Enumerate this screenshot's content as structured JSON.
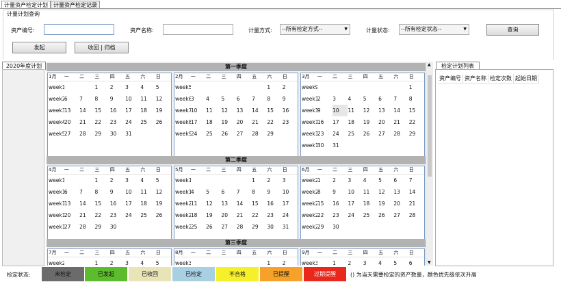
{
  "tabs": [
    {
      "label": "计量资产检定计划",
      "active": true
    },
    {
      "label": "计量资产检定记录",
      "active": false
    }
  ],
  "query": {
    "title": "计量计划查询",
    "asset_no_label": "资产编号:",
    "asset_name_label": "资产名称:",
    "method_label": "计量方式:",
    "method_value": "--所有检定方式--",
    "status_label": "计量状态:",
    "status_value": "--所有检定状态--",
    "search_label": "查询",
    "start_label": "发起",
    "recall_label": "收回 | 归档"
  },
  "year_tab": "2020年度计划",
  "list": {
    "tab": "检定计划列表",
    "columns": [
      "资产编号",
      "资产名称",
      "检定次数",
      "起始日期"
    ]
  },
  "weekday_headers": [
    "一",
    "二",
    "三",
    "四",
    "五",
    "六",
    "日"
  ],
  "quarters": [
    {
      "title": "第一季度",
      "months": [
        {
          "name": "1月",
          "rows": [
            {
              "w": "week1",
              "d": [
                "",
                "",
                "1",
                "2",
                "3",
                "4",
                "5"
              ]
            },
            {
              "w": "week2",
              "d": [
                "6",
                "7",
                "8",
                "9",
                "10",
                "11",
                "12"
              ]
            },
            {
              "w": "week3",
              "d": [
                "13",
                "14",
                "15",
                "16",
                "17",
                "18",
                "19"
              ]
            },
            {
              "w": "week4",
              "d": [
                "20",
                "21",
                "22",
                "23",
                "24",
                "25",
                "26"
              ]
            },
            {
              "w": "week5",
              "d": [
                "27",
                "28",
                "29",
                "30",
                "31",
                "",
                ""
              ]
            },
            {
              "w": "",
              "d": [
                "",
                "",
                "",
                "",
                "",
                "",
                ""
              ]
            }
          ]
        },
        {
          "name": "2月",
          "rows": [
            {
              "w": "week5",
              "d": [
                "",
                "",
                "",
                "",
                "",
                "1",
                "2"
              ]
            },
            {
              "w": "week6",
              "d": [
                "3",
                "4",
                "5",
                "6",
                "7",
                "8",
                "9"
              ]
            },
            {
              "w": "week7",
              "d": [
                "10",
                "11",
                "12",
                "13",
                "14",
                "15",
                "16"
              ]
            },
            {
              "w": "week8",
              "d": [
                "17",
                "18",
                "19",
                "20",
                "21",
                "22",
                "23"
              ]
            },
            {
              "w": "week9",
              "d": [
                "24",
                "25",
                "26",
                "27",
                "28",
                "29",
                ""
              ]
            },
            {
              "w": "",
              "d": [
                "",
                "",
                "",
                "",
                "",
                "",
                ""
              ]
            }
          ]
        },
        {
          "name": "3月",
          "rows": [
            {
              "w": "week9",
              "d": [
                "",
                "",
                "",
                "",
                "",
                "",
                "1"
              ]
            },
            {
              "w": "week10",
              "d": [
                "2",
                "3",
                "4",
                "5",
                "6",
                "7",
                "8"
              ]
            },
            {
              "w": "week11",
              "d": [
                "9",
                "10",
                "11",
                "12",
                "13",
                "14",
                "15"
              ]
            },
            {
              "w": "week12",
              "d": [
                "16",
                "17",
                "18",
                "19",
                "20",
                "21",
                "22"
              ]
            },
            {
              "w": "week13",
              "d": [
                "23",
                "24",
                "25",
                "26",
                "27",
                "28",
                "29"
              ]
            },
            {
              "w": "week14",
              "d": [
                "30",
                "31",
                "",
                "",
                "",
                "",
                ""
              ]
            }
          ]
        }
      ]
    },
    {
      "title": "第二季度",
      "months": [
        {
          "name": "4月",
          "rows": [
            {
              "w": "week1",
              "d": [
                "",
                "",
                "1",
                "2",
                "3",
                "4",
                "5"
              ]
            },
            {
              "w": "week1",
              "d": [
                "6",
                "7",
                "8",
                "9",
                "10",
                "11",
                "12"
              ]
            },
            {
              "w": "week1",
              "d": [
                "13",
                "14",
                "15",
                "16",
                "17",
                "18",
                "19"
              ]
            },
            {
              "w": "week1",
              "d": [
                "20",
                "21",
                "22",
                "23",
                "24",
                "25",
                "26"
              ]
            },
            {
              "w": "week1",
              "d": [
                "27",
                "28",
                "29",
                "30",
                "",
                "",
                ""
              ]
            }
          ]
        },
        {
          "name": "5月",
          "rows": [
            {
              "w": "week18",
              "d": [
                "",
                "",
                "",
                "",
                "1",
                "2",
                "3"
              ]
            },
            {
              "w": "week19",
              "d": [
                "4",
                "5",
                "6",
                "7",
                "8",
                "9",
                "10"
              ]
            },
            {
              "w": "week20",
              "d": [
                "11",
                "12",
                "13",
                "14",
                "15",
                "16",
                "17"
              ]
            },
            {
              "w": "week21",
              "d": [
                "18",
                "19",
                "20",
                "21",
                "22",
                "23",
                "24"
              ]
            },
            {
              "w": "week22",
              "d": [
                "25",
                "26",
                "27",
                "28",
                "29",
                "30",
                "31"
              ]
            }
          ]
        },
        {
          "name": "6月",
          "rows": [
            {
              "w": "week23",
              "d": [
                "1",
                "2",
                "3",
                "4",
                "5",
                "6",
                "7"
              ]
            },
            {
              "w": "week24",
              "d": [
                "8",
                "9",
                "10",
                "11",
                "12",
                "13",
                "14"
              ]
            },
            {
              "w": "week25",
              "d": [
                "15",
                "16",
                "17",
                "18",
                "19",
                "20",
                "21"
              ]
            },
            {
              "w": "week26",
              "d": [
                "22",
                "23",
                "24",
                "25",
                "26",
                "27",
                "28"
              ]
            },
            {
              "w": "week27",
              "d": [
                "29",
                "30",
                "",
                "",
                "",
                "",
                ""
              ]
            }
          ]
        }
      ]
    },
    {
      "title": "第三季度",
      "months": [
        {
          "name": "7月",
          "rows": [
            {
              "w": "week27",
              "d": [
                "",
                "",
                "1",
                "2",
                "3",
                "4",
                "5"
              ]
            }
          ]
        },
        {
          "name": "8月",
          "rows": [
            {
              "w": "week31",
              "d": [
                "",
                "",
                "",
                "",
                "",
                "1",
                "2"
              ]
            }
          ]
        },
        {
          "name": "9月",
          "rows": [
            {
              "w": "week36",
              "d": [
                "",
                "1",
                "2",
                "3",
                "4",
                "5",
                "6"
              ]
            }
          ]
        }
      ]
    }
  ],
  "legend": {
    "label": "检定状态:",
    "items": [
      {
        "label": "未检定",
        "color": "#6b6b6b"
      },
      {
        "label": "已发起",
        "color": "#5dbb2e"
      },
      {
        "label": "已收回",
        "color": "#e8e4b8"
      },
      {
        "label": "已检定",
        "color": "#a9cfe3"
      },
      {
        "label": "不合格",
        "color": "#f5f02a"
      },
      {
        "label": "已提醒",
        "color": "#f6a22a"
      },
      {
        "label": "过期提醒",
        "color": "#e8281c"
      }
    ],
    "note": "() 为当天需要检定的资产数量，颜色优先级依次升高"
  },
  "highlight": {
    "q": 0,
    "m": 2,
    "r": 2,
    "c": 1
  }
}
